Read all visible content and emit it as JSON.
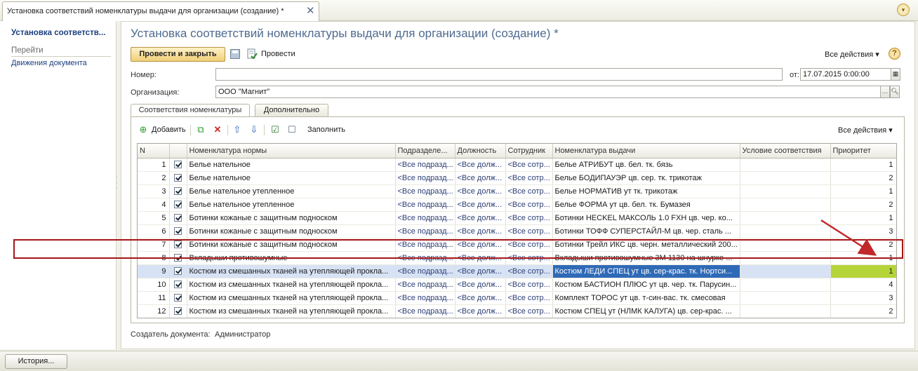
{
  "window": {
    "tab_title": "Установка соответствий номенклатуры выдачи для организации (создание) *",
    "close_glyph": "✕",
    "menu_glyph": "▾"
  },
  "nav": {
    "title": "Установка соответств...",
    "group": "Перейти",
    "link": "Движения документа"
  },
  "form": {
    "title": "Установка соответствий номенклатуры выдачи для организации (создание) *",
    "post_and_close": "Провести и закрыть",
    "post": "Провести",
    "all_actions": "Все действия",
    "help": "?",
    "number_label": "Номер:",
    "number_value": "",
    "date_label": "от:",
    "date_value": "17.07.2015  0:00:00",
    "org_label": "Организация:",
    "org_value": "ООО \"Магнит\"",
    "tabs": [
      "Соответствия номенклатуры",
      "Дополнительно"
    ]
  },
  "table_toolbar": {
    "add": "Добавить",
    "fill": "Заполнить",
    "all_actions": "Все действия"
  },
  "table": {
    "columns": [
      "N",
      "",
      "Номенклатура нормы",
      "Подразделе...",
      "Должность",
      "Сотрудник",
      "Номенклатура выдачи",
      "Условие соответствия",
      "Приоритет"
    ],
    "rows": [
      {
        "n": "1",
        "norm": "Белье нательное",
        "dept": "<Все подразд...",
        "pos": "<Все долж...",
        "emp": "<Все сотр...",
        "item": "Белье АТРИБУТ цв. бел. тк. бязь",
        "cond": "",
        "prio": "1"
      },
      {
        "n": "2",
        "norm": "Белье нательное",
        "dept": "<Все подразд...",
        "pos": "<Все долж...",
        "emp": "<Все сотр...",
        "item": "Белье БОДИПАУЭР цв. сер. тк. трикотаж",
        "cond": "",
        "prio": "2"
      },
      {
        "n": "3",
        "norm": "Белье нательное утепленное",
        "dept": "<Все подразд...",
        "pos": "<Все долж...",
        "emp": "<Все сотр...",
        "item": "Белье НОРМАТИВ ут тк. трикотаж",
        "cond": "",
        "prio": "1"
      },
      {
        "n": "4",
        "norm": "Белье нательное утепленное",
        "dept": "<Все подразд...",
        "pos": "<Все долж...",
        "emp": "<Все сотр...",
        "item": "Белье ФОРМА ут цв. бел. тк. Бумазея",
        "cond": "",
        "prio": "2"
      },
      {
        "n": "5",
        "norm": "Ботинки кожаные с защитным подноском",
        "dept": "<Все подразд...",
        "pos": "<Все долж...",
        "emp": "<Все сотр...",
        "item": "Ботинки HECKEL МАКСОЛЬ 1.0 FXH цв. чер. ко...",
        "cond": "",
        "prio": "1"
      },
      {
        "n": "6",
        "norm": "Ботинки кожаные с защитным подноском",
        "dept": "<Все подразд...",
        "pos": "<Все долж...",
        "emp": "<Все сотр...",
        "item": "Ботинки ТОФФ СУПЕРСТАЙЛ-М цв. чер. сталь ...",
        "cond": "",
        "prio": "3"
      },
      {
        "n": "7",
        "norm": "Ботинки кожаные с защитным подноском",
        "dept": "<Все подразд...",
        "pos": "<Все долж...",
        "emp": "<Все сотр...",
        "item": "Ботинки Трейл ИКС цв. черн. металлический 200...",
        "cond": "",
        "prio": "2"
      },
      {
        "n": "8",
        "norm": "Вкладыши противошумные",
        "dept": "<Все подразд...",
        "pos": "<Все долж...",
        "emp": "<Все сотр...",
        "item": "Вкладыши противошумные 3М 1130 на шнурке ...",
        "cond": "",
        "prio": "1"
      },
      {
        "n": "9",
        "norm": "Костюм из смешанных тканей на утепляющей прокла...",
        "dept": "<Все подразд...",
        "pos": "<Все долж...",
        "emp": "<Все сотр...",
        "item": "Костюм ЛЕДИ СПЕЦ ут цв. сер-крас. тк. Нортси...",
        "cond": "",
        "prio": "1",
        "selected": true
      },
      {
        "n": "10",
        "norm": "Костюм из смешанных тканей на утепляющей прокла...",
        "dept": "<Все подразд...",
        "pos": "<Все долж...",
        "emp": "<Все сотр...",
        "item": "Костюм БАСТИОН ПЛЮС ут цв. чер. тк. Парусин...",
        "cond": "",
        "prio": "4"
      },
      {
        "n": "11",
        "norm": "Костюм из смешанных тканей на утепляющей прокла...",
        "dept": "<Все подразд...",
        "pos": "<Все долж...",
        "emp": "<Все сотр...",
        "item": "Комплект ТОРОС ут цв. т-син-вас. тк. смесовая",
        "cond": "",
        "prio": "3"
      },
      {
        "n": "12",
        "norm": "Костюм из смешанных тканей на утепляющей прокла...",
        "dept": "<Все подразд...",
        "pos": "<Все долж...",
        "emp": "<Все сотр...",
        "item": "Костюм СПЕЦ ут (НЛМК КАЛУГА) цв. сер-крас. ...",
        "cond": "",
        "prio": "2"
      }
    ]
  },
  "footer": {
    "creator_label": "Создатель документа:",
    "creator_value": "Администратор",
    "history": "История..."
  },
  "colors": {
    "accent_title": "#4f6b8f",
    "selection": "#2f6ab7",
    "highlight": "#b5d43a",
    "annotation_red": "#c0282a"
  }
}
